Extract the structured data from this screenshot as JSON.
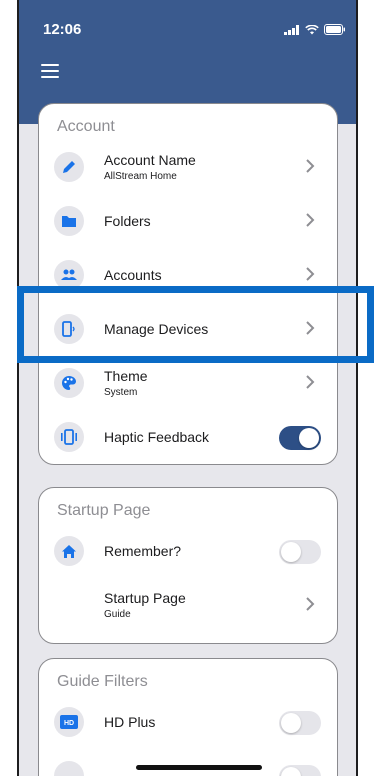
{
  "status_bar": {
    "time": "12:06"
  },
  "header": {
    "menu_icon": "hamburger-menu-icon",
    "color": "#3a5a8e"
  },
  "account": {
    "title": "Account",
    "items": [
      {
        "label": "Account Name",
        "sub": "AllStream Home",
        "icon": "pencil-icon",
        "control": "chevron"
      },
      {
        "label": "Folders",
        "sub": "",
        "icon": "folder-icon",
        "control": "chevron"
      },
      {
        "label": "Accounts",
        "sub": "",
        "icon": "people-icon",
        "control": "chevron"
      },
      {
        "label": "Manage Devices",
        "sub": "",
        "icon": "device-icon",
        "control": "chevron"
      },
      {
        "label": "Theme",
        "sub": "System",
        "icon": "palette-icon",
        "control": "chevron"
      },
      {
        "label": "Haptic Feedback",
        "sub": "",
        "icon": "vibration-icon",
        "control": "toggle",
        "on": true
      }
    ]
  },
  "startup": {
    "title": "Startup Page",
    "items": [
      {
        "label": "Remember?",
        "icon": "home-icon",
        "control": "toggle",
        "on": false
      },
      {
        "label": "Startup Page",
        "sub": "Guide",
        "control": "chevron"
      }
    ]
  },
  "guide_filters": {
    "title": "Guide Filters",
    "items": [
      {
        "label": "HD Plus",
        "icon": "hd-icon",
        "control": "toggle",
        "on": false
      }
    ]
  },
  "colors": {
    "accent": "#1a73e8",
    "highlight": "#0a6bc6",
    "toggle_on": "#2d4f86"
  }
}
